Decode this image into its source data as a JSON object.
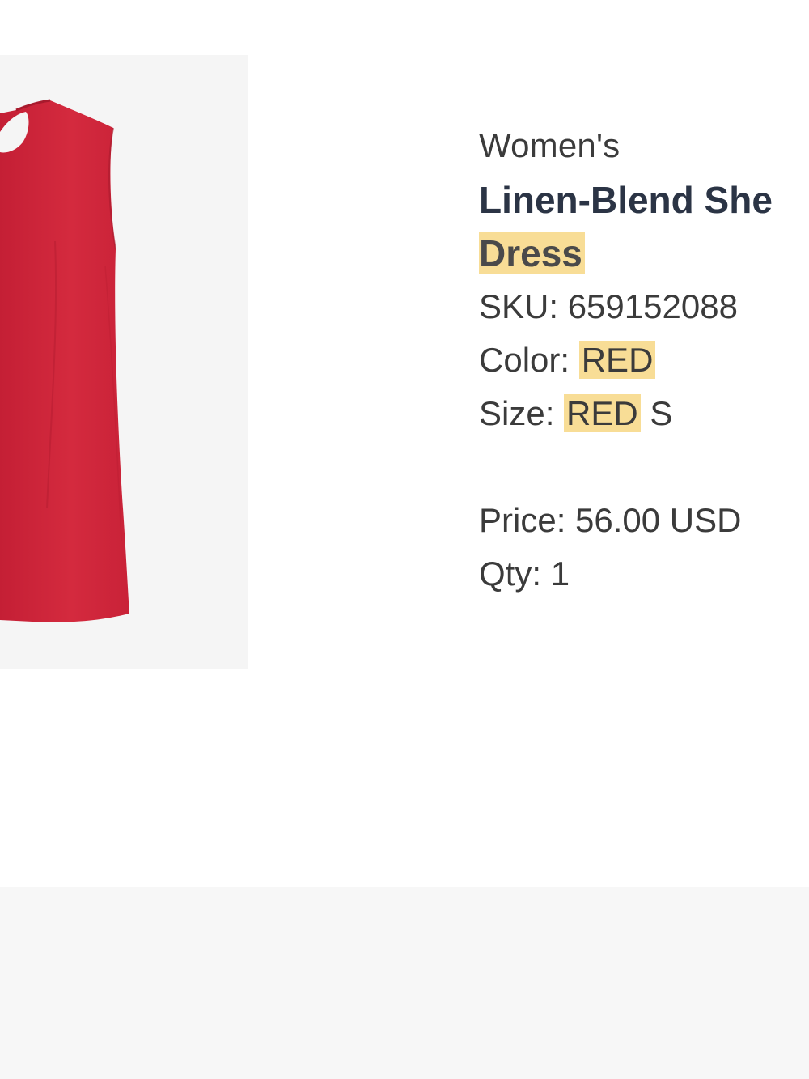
{
  "product": {
    "category": "Women's",
    "name_line1": "Linen-Blend She",
    "name_line2": "Dress",
    "sku_label": "SKU:",
    "sku": "659152088",
    "color_label": "Color:",
    "color": "RED",
    "size_label": "Size:",
    "size_highlight": "RED",
    "size": "S",
    "price_label": "Price:",
    "price": "56.00 USD",
    "qty_label": "Qty:",
    "qty": "1"
  },
  "colors": {
    "dress": "#d42a3e",
    "highlight": "#f8dd96",
    "title_text": "#2b3445",
    "body_text": "#3b3b3b",
    "image_background": "#f5f5f5",
    "footer_background": "#f7f7f7"
  },
  "image": {
    "subject": "red sleeveless dress"
  }
}
